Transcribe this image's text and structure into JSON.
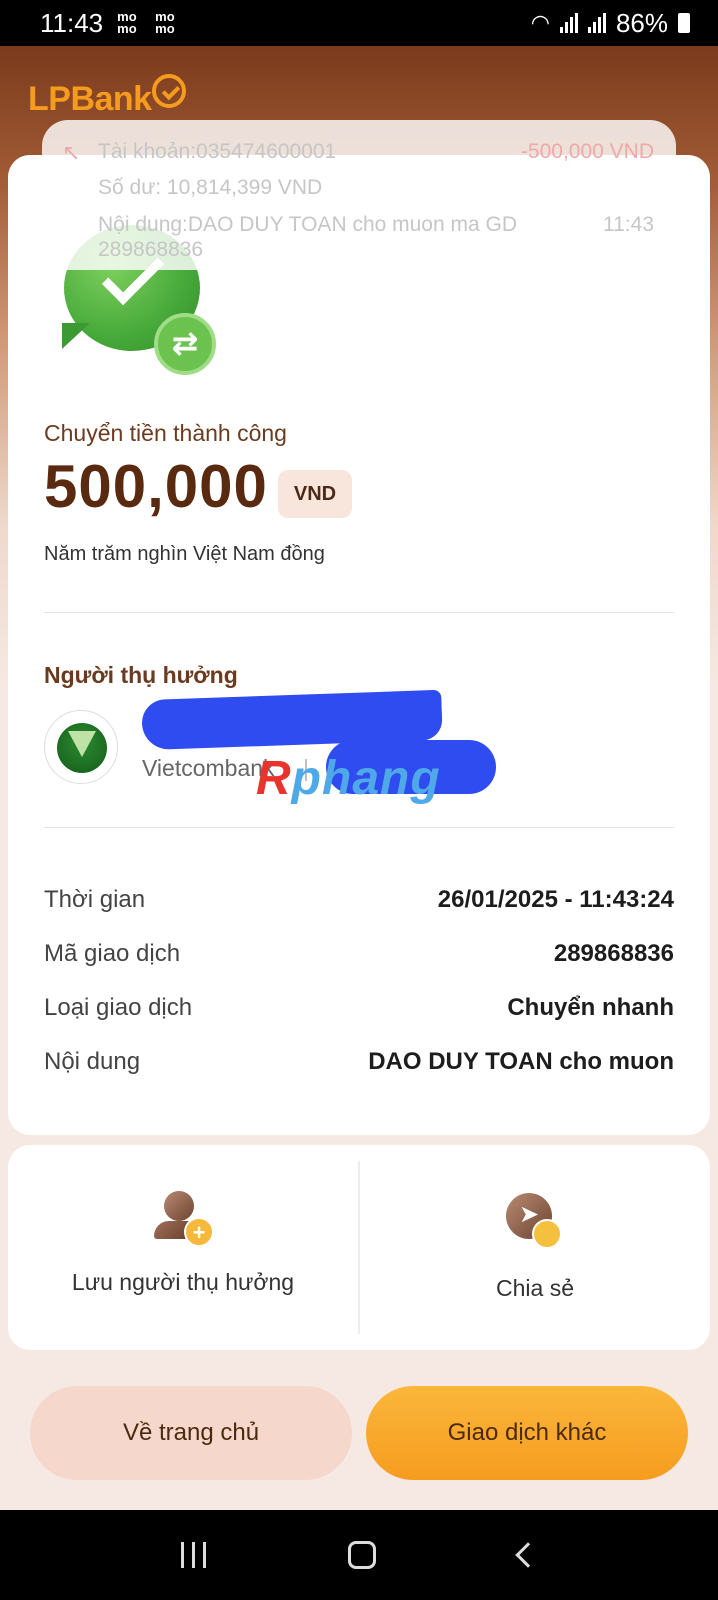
{
  "status_bar": {
    "time": "11:43",
    "momo_icons": [
      "mo\nmo",
      "mo\nmo"
    ],
    "battery": "86%"
  },
  "header": {
    "logo_text": "LPBank"
  },
  "notification": {
    "account": "Tài khoản:035474600001",
    "amount": "-500,000 VND",
    "balance": "Số dư: 10,814,399  VND",
    "content": "Nội dung:DAO DUY TOAN cho muon ma GD 289868836",
    "time": "11:43"
  },
  "receipt": {
    "success_label": "Chuyển tiền thành công",
    "amount": "500,000",
    "currency": "VND",
    "amount_in_words": "Năm trăm nghìn Việt Nam đồng",
    "beneficiary_title": "Người thụ hưởng",
    "bank_name": "Vietcombank",
    "watermark_red": "R",
    "watermark_rest": "phang",
    "details": [
      {
        "label": "Thời gian",
        "value": "26/01/2025 - 11:43:24"
      },
      {
        "label": "Mã giao dịch",
        "value": "289868836"
      },
      {
        "label": "Loại giao dịch",
        "value": "Chuyển nhanh"
      },
      {
        "label": "Nội dung",
        "value": "DAO DUY TOAN cho muon"
      }
    ]
  },
  "actions": {
    "save_beneficiary": "Lưu người thụ hưởng",
    "share": "Chia sẻ"
  },
  "buttons": {
    "home": "Về trang chủ",
    "other_transaction": "Giao dịch khác"
  },
  "colors": {
    "brand": "#f59c1f",
    "amount": "#5a2a10",
    "success": "#46a93a"
  }
}
